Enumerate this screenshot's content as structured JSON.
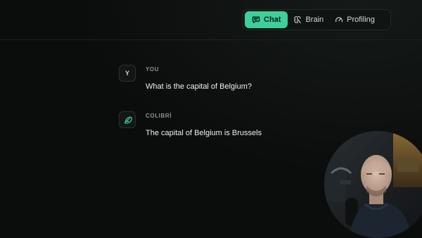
{
  "header": {
    "tabs": [
      {
        "label": "Chat",
        "icon": "chat-icon",
        "active": true
      },
      {
        "label": "Brain",
        "icon": "brain-icon",
        "active": false
      },
      {
        "label": "Profiling",
        "icon": "gauge-icon",
        "active": false
      }
    ]
  },
  "messages": [
    {
      "avatar": "Y",
      "sender": "YOU",
      "text": "What is the capital of Belgium?"
    },
    {
      "avatar_icon": "feather-icon",
      "sender": "COLIBRÌ",
      "text": "The capital of Belgium is Brussels"
    }
  ],
  "colors": {
    "accent": "#3ecf9a",
    "background": "#0b0d0c"
  }
}
